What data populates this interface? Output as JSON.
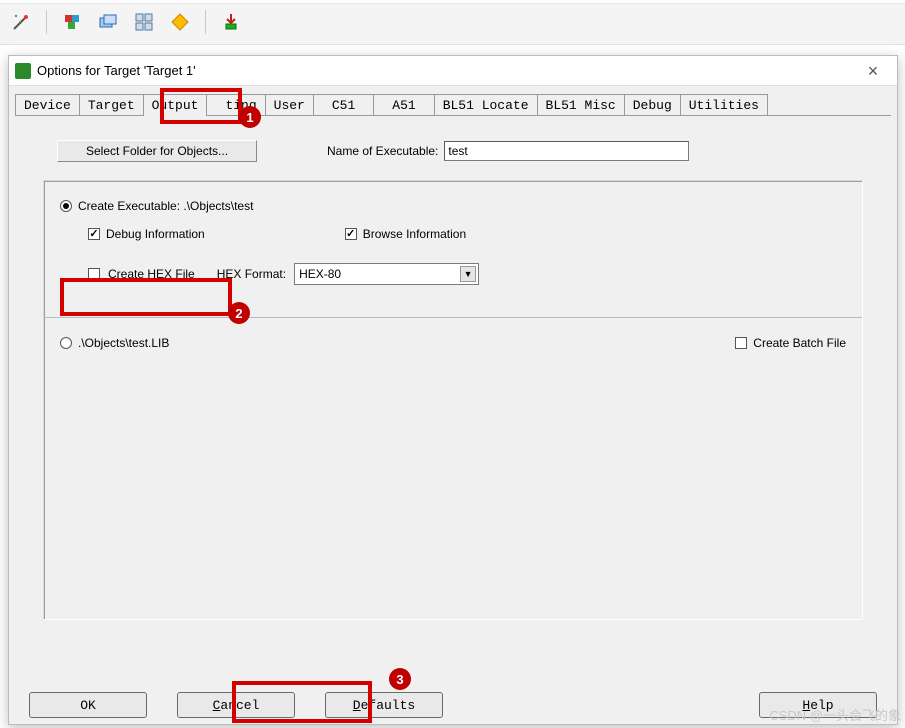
{
  "toolbar_icons": [
    "wand-icon",
    "cubes-icon",
    "layers-icon",
    "tiles-icon",
    "diamond-icon",
    "download-icon"
  ],
  "dialog": {
    "title": "Options for Target 'Target 1'",
    "tabs": [
      "Device",
      "Target",
      "Output",
      "Listing",
      "User",
      "C51",
      "A51",
      "BL51 Locate",
      "BL51 Misc",
      "Debug",
      "Utilities"
    ],
    "active_tab": "Output",
    "select_folder_btn": "Select Folder for Objects...",
    "name_label": "Name of Executable:",
    "name_value": "test",
    "create_exe_label": "Create Executable:  .\\Objects\\test",
    "debug_info_label": "Debug Information",
    "browse_info_label": "Browse Information",
    "create_hex_label": "Create HEX File",
    "hex_format_label": "HEX Format:",
    "hex_format_value": "HEX-80",
    "create_lib_label": ".\\Objects\\test.LIB",
    "batch_label": "Create Batch File",
    "buttons": {
      "ok": "OK",
      "cancel": "Cancel",
      "defaults": "Defaults",
      "help": "Help"
    }
  },
  "annotations": {
    "1": "1",
    "2": "2",
    "3": "3"
  },
  "watermark": "CSDN @一头会飞的象"
}
